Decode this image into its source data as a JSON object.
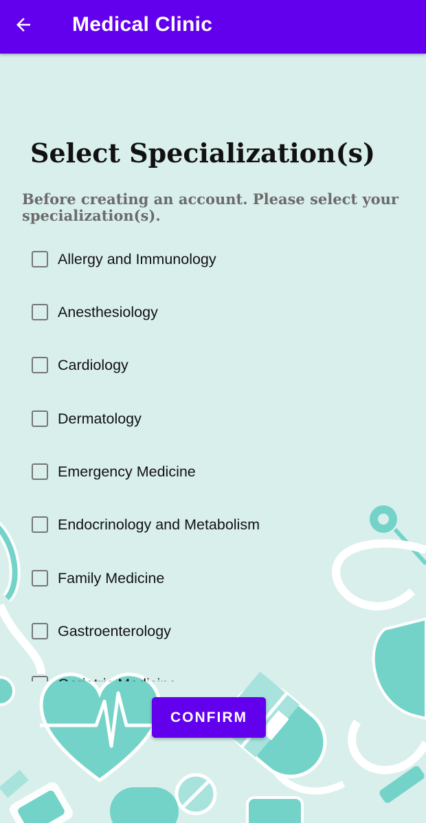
{
  "appbar": {
    "title": "Medical Clinic",
    "back_icon": "arrow-left-icon"
  },
  "page": {
    "heading": "Select Specialization(s)",
    "subtitle": "Before creating an account. Please select your specialization(s)."
  },
  "specializations": [
    {
      "label": "Allergy and Immunology",
      "checked": false
    },
    {
      "label": "Anesthesiology",
      "checked": false
    },
    {
      "label": "Cardiology",
      "checked": false
    },
    {
      "label": "Dermatology",
      "checked": false
    },
    {
      "label": "Emergency Medicine",
      "checked": false
    },
    {
      "label": "Endocrinology and Metabolism",
      "checked": false
    },
    {
      "label": "Family Medicine",
      "checked": false
    },
    {
      "label": "Gastroenterology",
      "checked": false
    },
    {
      "label": "Geriatric Medicine",
      "checked": false
    }
  ],
  "confirm_label": "CONFIRM",
  "colors": {
    "primary": "#6200ee",
    "background": "#d9efec",
    "illustration_teal": "#74d3c8"
  }
}
